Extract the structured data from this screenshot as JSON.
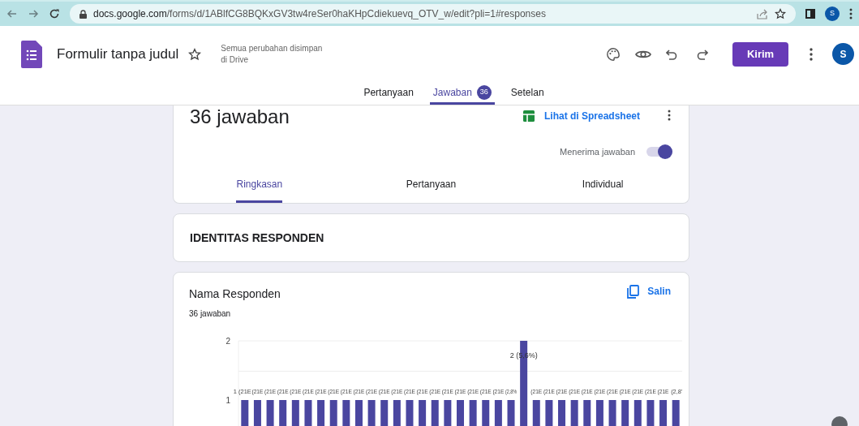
{
  "browser": {
    "url_host": "docs.google.com",
    "url_path": "/forms/d/1ABlfCG8BQKxGV3tw4reSer0haKHpCdiekuevq_OTV_w/edit?pli=1#responses",
    "profile_initial": "S"
  },
  "header": {
    "title": "Formulir tanpa judul",
    "save_status": "Semua perubahan disimpan di Drive",
    "send_button": "Kirim",
    "avatar_initial": "S"
  },
  "tabs": [
    {
      "label": "Pertanyaan",
      "selected": false
    },
    {
      "label": "Jawaban",
      "badge": "36",
      "selected": true
    },
    {
      "label": "Setelan",
      "selected": false
    }
  ],
  "summary": {
    "title": "36 jawaban",
    "spreadsheet_link": "Lihat di Spreadsheet",
    "accepting_label": "Menerima jawaban",
    "accepting": true,
    "tabs": [
      {
        "label": "Ringkasan",
        "selected": true
      },
      {
        "label": "Pertanyaan",
        "selected": false
      },
      {
        "label": "Individual",
        "selected": false
      }
    ]
  },
  "section": {
    "title": "IDENTITAS RESPONDEN"
  },
  "question": {
    "title": "Nama Responden",
    "copy_button": "Salin",
    "count": "36 jawaban",
    "chart_data": {
      "type": "bar",
      "color": "#4a46a0",
      "yticks": [
        1,
        2
      ],
      "ylim": [
        0,
        2
      ],
      "values": [
        1,
        1,
        1,
        1,
        1,
        1,
        1,
        1,
        1,
        1,
        1,
        1,
        1,
        1,
        1,
        1,
        1,
        1,
        1,
        1,
        1,
        1,
        2,
        1,
        1,
        1,
        1,
        1,
        1,
        1,
        1,
        1,
        1,
        1,
        1
      ]
    },
    "bar_labels": [
      "1 (21E",
      "(21E",
      "(21E",
      "(21E",
      "(21E",
      "(21E",
      "(21E",
      "(21E",
      "(21E",
      "(21E",
      "(21E",
      "(21E",
      "(21E",
      "(21E",
      "(21E",
      "(21E",
      "(21E",
      "(21E",
      "(21E",
      "(21E",
      "(21E",
      "(2,8%",
      "2 (5,6%)",
      "(21E",
      "(21E",
      "(21E",
      "(21E",
      "(21E",
      "(21E",
      "(21E",
      "(21E",
      "(21E",
      "(21E",
      "(21E",
      "(2,8'"
    ]
  }
}
